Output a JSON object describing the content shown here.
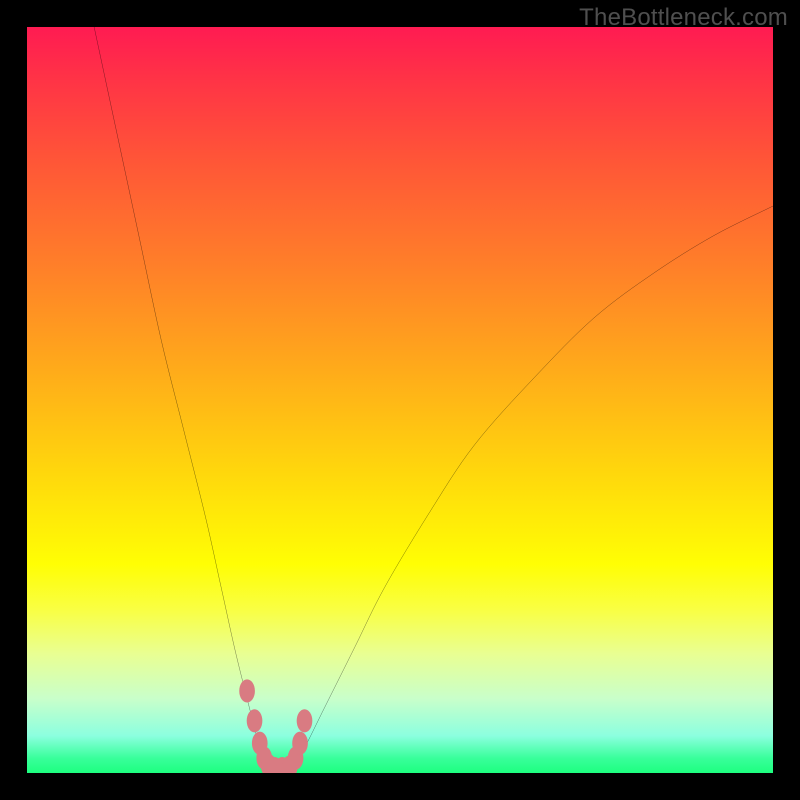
{
  "watermark": {
    "text": "TheBottleneck.com"
  },
  "chart_data": {
    "type": "line",
    "title": "",
    "xlabel": "",
    "ylabel": "",
    "xlim": [
      0,
      100
    ],
    "ylim": [
      0,
      100
    ],
    "grid": false,
    "legend": null,
    "background_colormap": "red-yellow-green vertical gradient (high=red top, low=green bottom)",
    "series": [
      {
        "name": "bottleneck-curve",
        "color": "#000000",
        "x": [
          9,
          12,
          15,
          18,
          21,
          24,
          26,
          28,
          30,
          31,
          32,
          33.5,
          35,
          37,
          40,
          44,
          48,
          54,
          60,
          68,
          76,
          84,
          92,
          100
        ],
        "y": [
          100,
          86,
          72,
          58,
          46,
          34,
          25,
          16,
          8,
          4,
          0,
          0,
          0,
          3,
          9,
          17,
          25,
          35,
          44,
          53,
          61,
          67,
          72,
          76
        ]
      }
    ],
    "highlight_segment": {
      "name": "optimal-range",
      "color": "#d97b82",
      "x": [
        29.5,
        30.5,
        31.2,
        31.8,
        32.4,
        33.2,
        34.2,
        35.2,
        36.0,
        36.6,
        37.2
      ],
      "y": [
        11,
        7,
        4,
        2,
        1,
        0.6,
        0.6,
        0.8,
        2,
        4,
        7
      ]
    }
  }
}
